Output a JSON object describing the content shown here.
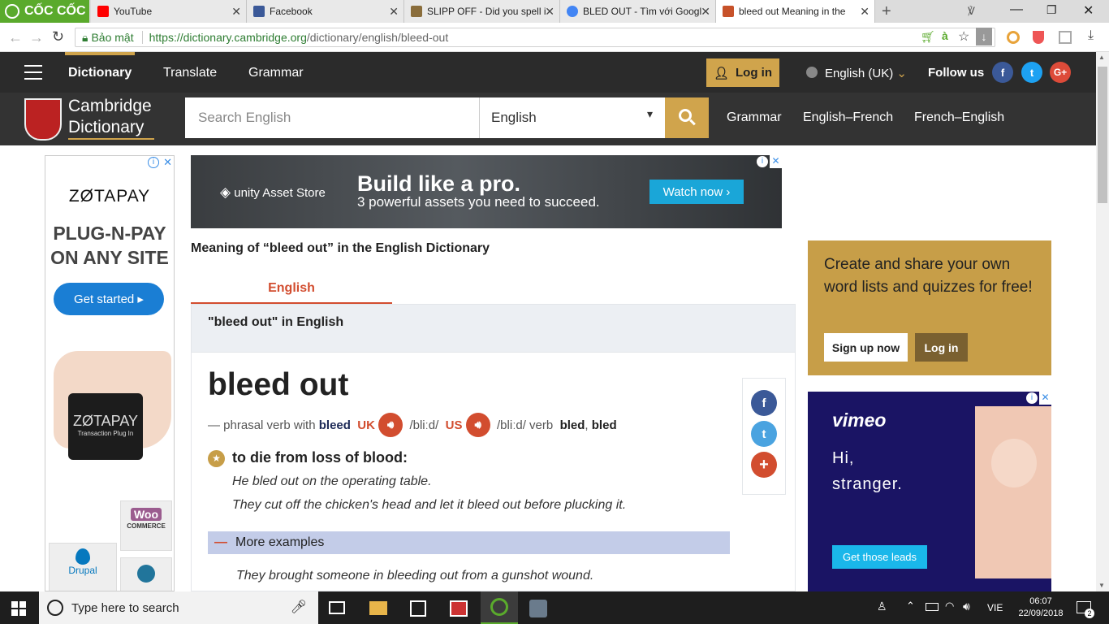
{
  "browser": {
    "brand": "CỐC CỐC",
    "tabs": [
      {
        "title": "YouTube",
        "color": "#ff0000"
      },
      {
        "title": "Facebook",
        "color": "#3b5998"
      },
      {
        "title": "SLIPP OFF - Did you spell i",
        "color": "#8a6d3b"
      },
      {
        "title": "BLED OUT - Tìm với Googl",
        "color": "#4285f4"
      },
      {
        "title": "bleed out Meaning in the",
        "color": "#c7522a"
      }
    ],
    "secure_label": "Bảo mật",
    "url_host": "https://dictionary.cambridge.org",
    "url_path": "/dictionary/english/bleed-out"
  },
  "header": {
    "nav": [
      "Dictionary",
      "Translate",
      "Grammar"
    ],
    "login": "Log in",
    "language": "English (UK)",
    "follow": "Follow us",
    "logo_line1": "Cambridge",
    "logo_line2": "Dictionary",
    "search_placeholder": "Search English",
    "search_lang": "English",
    "links": [
      "Grammar",
      "English–French",
      "French–English"
    ]
  },
  "left_ad": {
    "brand": "ZØTAPAY",
    "headline1": "PLUG-N-PAY",
    "headline2": "ON ANY SITE",
    "cta": "Get started ▸",
    "device_brand": "ZØTAPAY",
    "device_sub": "Transaction Plug In",
    "woo": "Woo",
    "commerce": "COMMERCE",
    "drupal": "Drupal"
  },
  "top_ad": {
    "brand": "unity Asset Store",
    "headline": "Build like a pro.",
    "sub": "3 powerful assets you need to succeed.",
    "cta": "Watch now ›"
  },
  "entry": {
    "meaning_heading": "Meaning of “bleed out” in the English Dictionary",
    "tab": "English",
    "in_english": "\"bleed out\" in English",
    "headword": "bleed out",
    "pos_prefix": "— phrasal verb with",
    "pos_base": "bleed",
    "uk": "UK",
    "uk_ipa": "/bliːd/",
    "us": "US",
    "us_ipa": "/bliːd/",
    "verb": "verb",
    "forms": "bled",
    "forms_sep": ",",
    "forms2": "bled",
    "definition": "to die from loss of blood:",
    "examples": [
      "He bled out on the operating table.",
      "They cut off the chicken's head and let it bleed out before plucking it."
    ],
    "more_examples": "More examples",
    "more_example_1": "They brought someone in bleeding out from a gunshot wound."
  },
  "sidebar": {
    "promo": "Create and share your own word lists and quizzes for free!",
    "signup": "Sign up now",
    "login": "Log in"
  },
  "vimeo_ad": {
    "brand": "vimeo",
    "line1": "Hi,",
    "line2": "stranger.",
    "cta": "Get those leads"
  },
  "taskbar": {
    "search": "Type here to search",
    "lang": "VIE",
    "time": "06:07",
    "date": "22/09/2018",
    "notif": "2"
  }
}
